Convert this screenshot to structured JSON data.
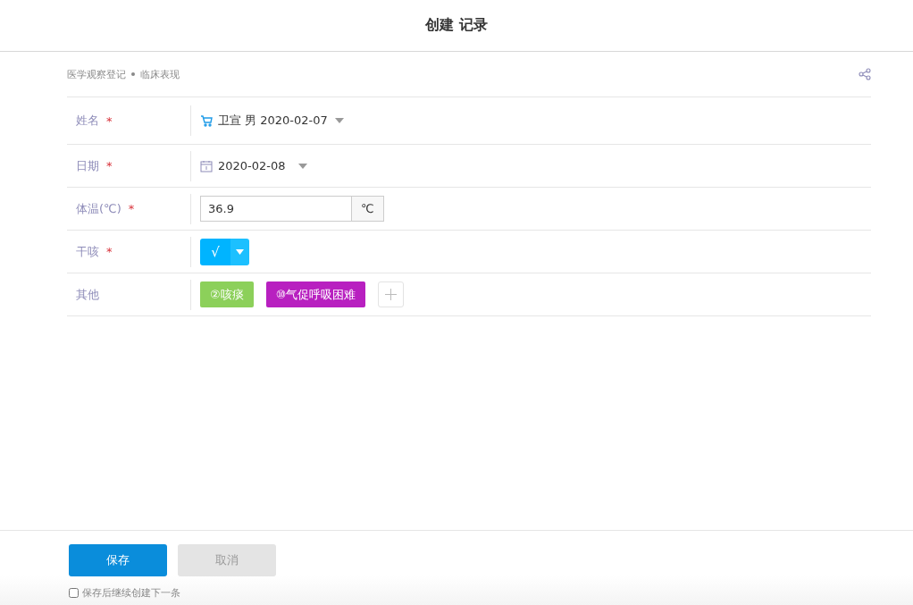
{
  "header": {
    "title": "创建 记录"
  },
  "breadcrumb": [
    "医学观察登记",
    "临床表现"
  ],
  "fields": [
    {
      "kind": "person",
      "label": "姓名",
      "required_mark": "*",
      "value": "卫宣 男 2020-02-07"
    },
    {
      "kind": "date",
      "label": "日期",
      "required_mark": "*",
      "value": "2020-02-08"
    },
    {
      "kind": "number",
      "label": "体温(℃)",
      "required_mark": "*",
      "value": "36.9",
      "unit": "℃"
    },
    {
      "kind": "toggle",
      "label": "干咳",
      "required_mark": "*",
      "value": "√"
    },
    {
      "kind": "tags",
      "label": "其他",
      "tags": [
        {
          "text": "②咳痰",
          "color": "#8cd05a"
        },
        {
          "text": "⑩气促呼吸困难",
          "color": "#b820c0"
        }
      ]
    }
  ],
  "buttons": [
    {
      "label": "保存",
      "kind": "primary"
    },
    {
      "label": "取消",
      "kind": "secondary"
    }
  ],
  "continue_option": {
    "label": "保存后继续创建下一条",
    "checked": false
  }
}
